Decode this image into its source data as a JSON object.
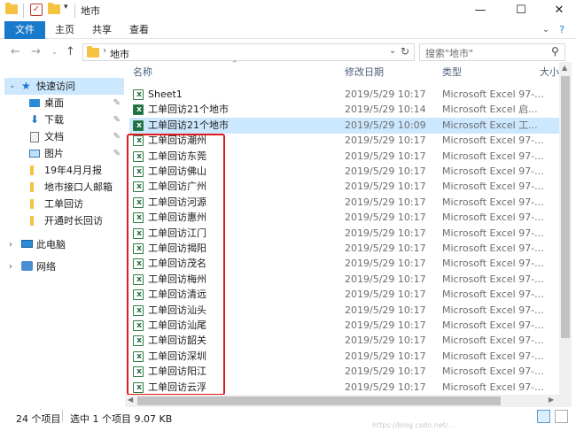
{
  "window": {
    "title": "地市"
  },
  "ribbon": {
    "tabs": [
      "文件",
      "主页",
      "共享",
      "查看"
    ]
  },
  "address": {
    "path": "地市",
    "search_placeholder": "搜索\"地市\""
  },
  "nav": {
    "quick_access": "快速访问",
    "pinned": [
      "桌面",
      "下载",
      "文档",
      "图片"
    ],
    "folders": [
      "19年4月月报",
      "地市接口人邮箱",
      "工单回访",
      "开通时长回访"
    ],
    "this_pc": "此电脑",
    "network": "网络"
  },
  "columns": {
    "name": "名称",
    "date": "修改日期",
    "type": "类型",
    "size": "大小"
  },
  "files": [
    {
      "name": "Sheet1",
      "date": "2019/5/29 10:17",
      "type": "Microsoft Excel 97-..."
    },
    {
      "name": "工单回访21个地市",
      "date": "2019/5/29 10:14",
      "type": "Microsoft Excel 启..."
    },
    {
      "name": "工单回访21个地市",
      "date": "2019/5/29 10:09",
      "type": "Microsoft Excel 工..."
    },
    {
      "name": "工单回访潮州",
      "date": "2019/5/29 10:17",
      "type": "Microsoft Excel 97-..."
    },
    {
      "name": "工单回访东莞",
      "date": "2019/5/29 10:17",
      "type": "Microsoft Excel 97-..."
    },
    {
      "name": "工单回访佛山",
      "date": "2019/5/29 10:17",
      "type": "Microsoft Excel 97-..."
    },
    {
      "name": "工单回访广州",
      "date": "2019/5/29 10:17",
      "type": "Microsoft Excel 97-..."
    },
    {
      "name": "工单回访河源",
      "date": "2019/5/29 10:17",
      "type": "Microsoft Excel 97-..."
    },
    {
      "name": "工单回访惠州",
      "date": "2019/5/29 10:17",
      "type": "Microsoft Excel 97-..."
    },
    {
      "name": "工单回访江门",
      "date": "2019/5/29 10:17",
      "type": "Microsoft Excel 97-..."
    },
    {
      "name": "工单回访揭阳",
      "date": "2019/5/29 10:17",
      "type": "Microsoft Excel 97-..."
    },
    {
      "name": "工单回访茂名",
      "date": "2019/5/29 10:17",
      "type": "Microsoft Excel 97-..."
    },
    {
      "name": "工单回访梅州",
      "date": "2019/5/29 10:17",
      "type": "Microsoft Excel 97-..."
    },
    {
      "name": "工单回访清远",
      "date": "2019/5/29 10:17",
      "type": "Microsoft Excel 97-..."
    },
    {
      "name": "工单回访汕头",
      "date": "2019/5/29 10:17",
      "type": "Microsoft Excel 97-..."
    },
    {
      "name": "工单回访汕尾",
      "date": "2019/5/29 10:17",
      "type": "Microsoft Excel 97-..."
    },
    {
      "name": "工单回访韶关",
      "date": "2019/5/29 10:17",
      "type": "Microsoft Excel 97-..."
    },
    {
      "name": "工单回访深圳",
      "date": "2019/5/29 10:17",
      "type": "Microsoft Excel 97-..."
    },
    {
      "name": "工单回访阳江",
      "date": "2019/5/29 10:17",
      "type": "Microsoft Excel 97-..."
    },
    {
      "name": "工单回访云浮",
      "date": "2019/5/29 10:17",
      "type": "Microsoft Excel 97-..."
    }
  ],
  "status": {
    "count": "24 个项目",
    "selection": "选中 1 个项目  9.07 KB"
  },
  "watermark": "https://blog.csdn.net/..."
}
